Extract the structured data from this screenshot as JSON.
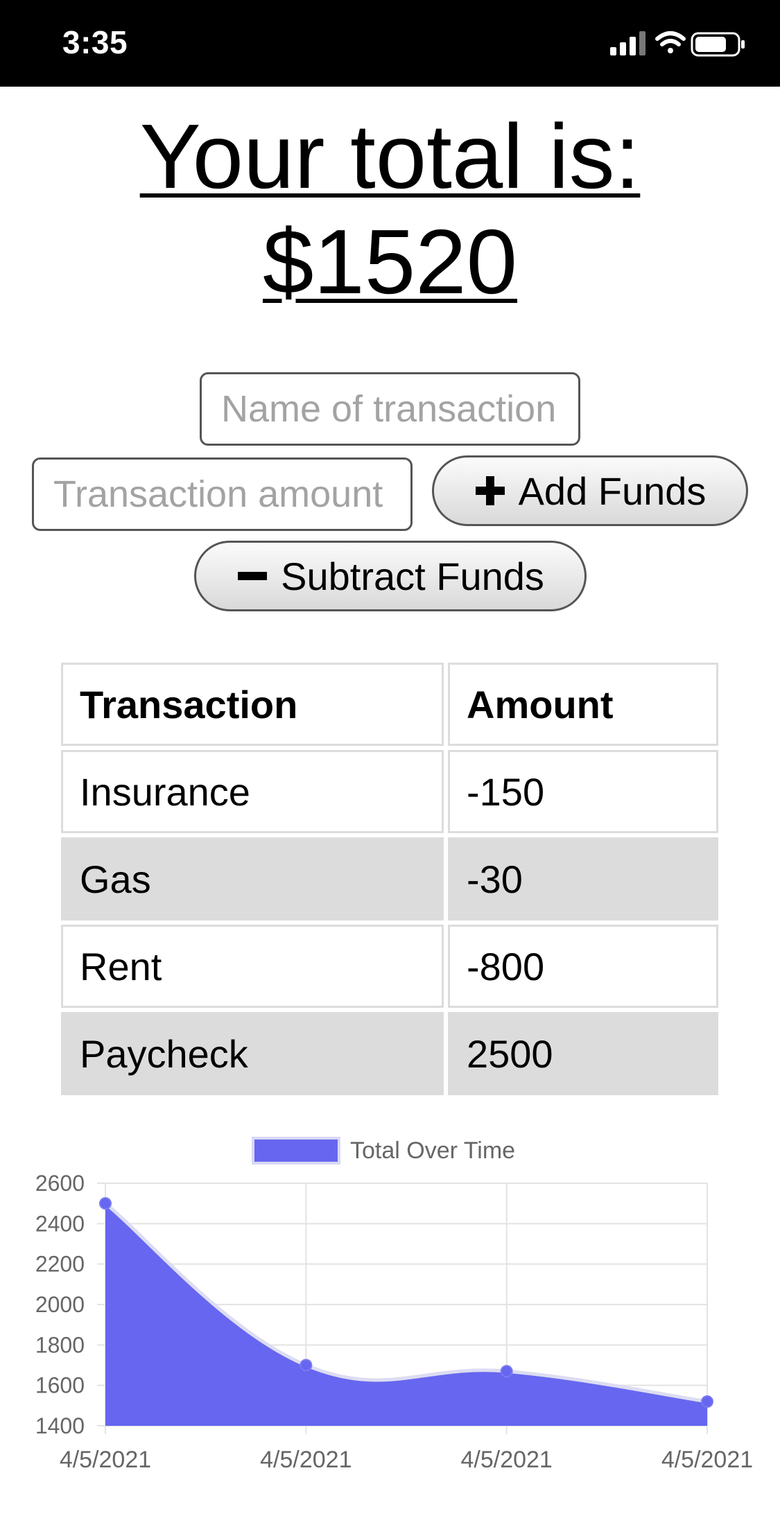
{
  "status_bar": {
    "time": "3:35",
    "icons": [
      "cellular-signal-icon",
      "wifi-icon",
      "battery-icon"
    ]
  },
  "heading": {
    "line1": "Your total is:",
    "line2": "$1520"
  },
  "form": {
    "name_placeholder": "Name of transaction",
    "amount_placeholder": "Transaction amount",
    "add_label": "Add Funds",
    "add_icon": "plus-icon",
    "subtract_label": "Subtract Funds",
    "subtract_icon": "minus-icon"
  },
  "table": {
    "headers": [
      "Transaction",
      "Amount"
    ],
    "rows": [
      {
        "name": "Insurance",
        "amount": "-150"
      },
      {
        "name": "Gas",
        "amount": "-30"
      },
      {
        "name": "Rent",
        "amount": "-800"
      },
      {
        "name": "Paycheck",
        "amount": "2500"
      }
    ]
  },
  "chart_data": {
    "type": "area",
    "x": [
      "4/5/2021",
      "4/5/2021",
      "4/5/2021",
      "4/5/2021"
    ],
    "series": [
      {
        "name": "Total Over Time",
        "values": [
          2500,
          1700,
          1670,
          1520
        ],
        "color": "#6666f0"
      }
    ],
    "ylim": [
      1400,
      2600
    ],
    "yticks": [
      1400,
      1600,
      1800,
      2000,
      2200,
      2400,
      2600
    ],
    "grid": true,
    "legend": "top-center"
  }
}
